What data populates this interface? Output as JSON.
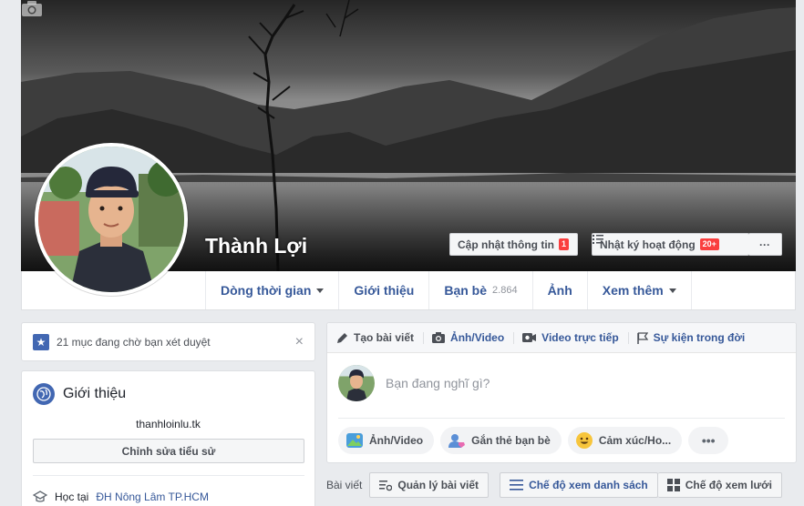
{
  "profile": {
    "name": "Thành Lợi"
  },
  "cover_actions": {
    "update_info": "Cập nhật thông tin",
    "update_info_badge": "1",
    "activity_log": "Nhật ký hoạt động",
    "activity_log_badge": "20+",
    "more": "···"
  },
  "tabs": {
    "timeline": "Dòng thời gian",
    "about": "Giới thiệu",
    "friends": "Bạn bè",
    "friends_count": "2.864",
    "photos": "Ảnh",
    "more": "Xem thêm"
  },
  "pending": {
    "text": "21 mục đang chờ bạn xét duyệt",
    "close": "×"
  },
  "intro": {
    "title": "Giới thiệu",
    "bio": "thanhloinlu.tk",
    "edit_bio": "Chỉnh sửa tiểu sử",
    "edu_prefix": "Học tại",
    "edu_school": "ĐH Nông Lâm TP.HCM"
  },
  "composer": {
    "tab_create": "Tạo bài viết",
    "tab_photo": "Ảnh/Video",
    "tab_live": "Video trực tiếp",
    "tab_event": "Sự kiện trong đời",
    "placeholder": "Bạn đang nghĩ gì?",
    "pill_photo": "Ảnh/Video",
    "pill_tag": "Gắn thẻ bạn bè",
    "pill_feeling": "Cảm xúc/Ho...",
    "pill_more": "•••"
  },
  "postbar": {
    "label": "Bài viết",
    "manage": "Quản lý bài viết",
    "list_view": "Chế độ xem danh sách",
    "grid_view": "Chế độ xem lưới"
  },
  "colors": {
    "accent": "#4267b2",
    "link": "#365899",
    "badge": "#fa3e3e"
  }
}
